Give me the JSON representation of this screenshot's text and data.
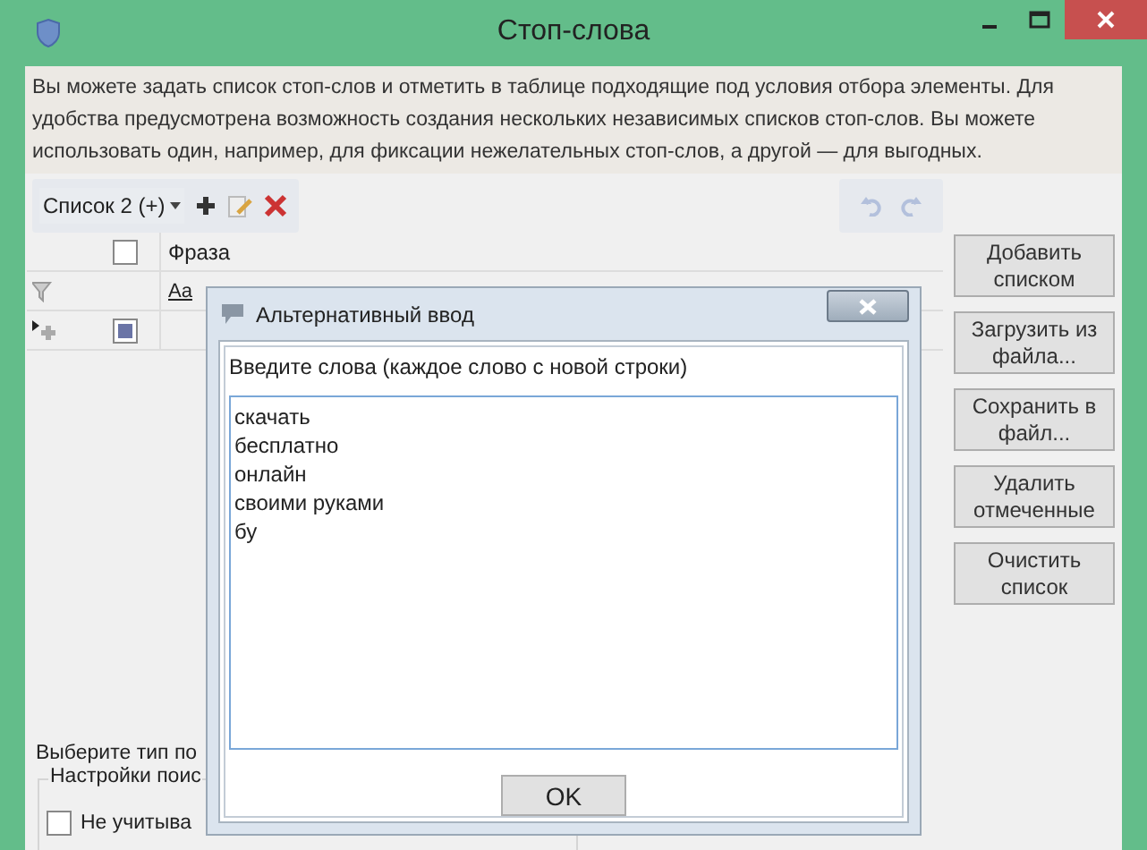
{
  "window": {
    "title": "Стоп-слова"
  },
  "description": "Вы можете задать список стоп-слов и отметить в таблице подходящие под условия отбора элементы. Для удобства предусмотрена возможность создания нескольких независимых списков стоп-слов. Вы можете использовать один, например, для фиксации нежелательных стоп-слов, а другой — для выгодных.",
  "toolbar": {
    "list_selector": "Список 2 (+)",
    "undo": {
      "disabled": true
    },
    "redo": {
      "disabled": true
    }
  },
  "table": {
    "select_all": {
      "checked": false
    },
    "column": "Фраза",
    "match_case": "Aa",
    "new_row": {
      "indeterminate": true
    }
  },
  "side_buttons": [
    "Добавить списком",
    "Загрузить из файла...",
    "Сохранить в файл...",
    "Удалить отмеченные",
    "Очистить список"
  ],
  "search_type_label": "Выберите тип по",
  "settings_group": {
    "title": "Настройки поис",
    "option": {
      "label": "Не учитыва",
      "checked": false
    }
  },
  "dialog": {
    "title": "Альтернативный ввод",
    "prompt": "Введите слова (каждое слово с новой строки)",
    "words": [
      "скачать",
      "бесплатно",
      "онлайн",
      "своими руками",
      "бу"
    ],
    "ok": "OK"
  }
}
